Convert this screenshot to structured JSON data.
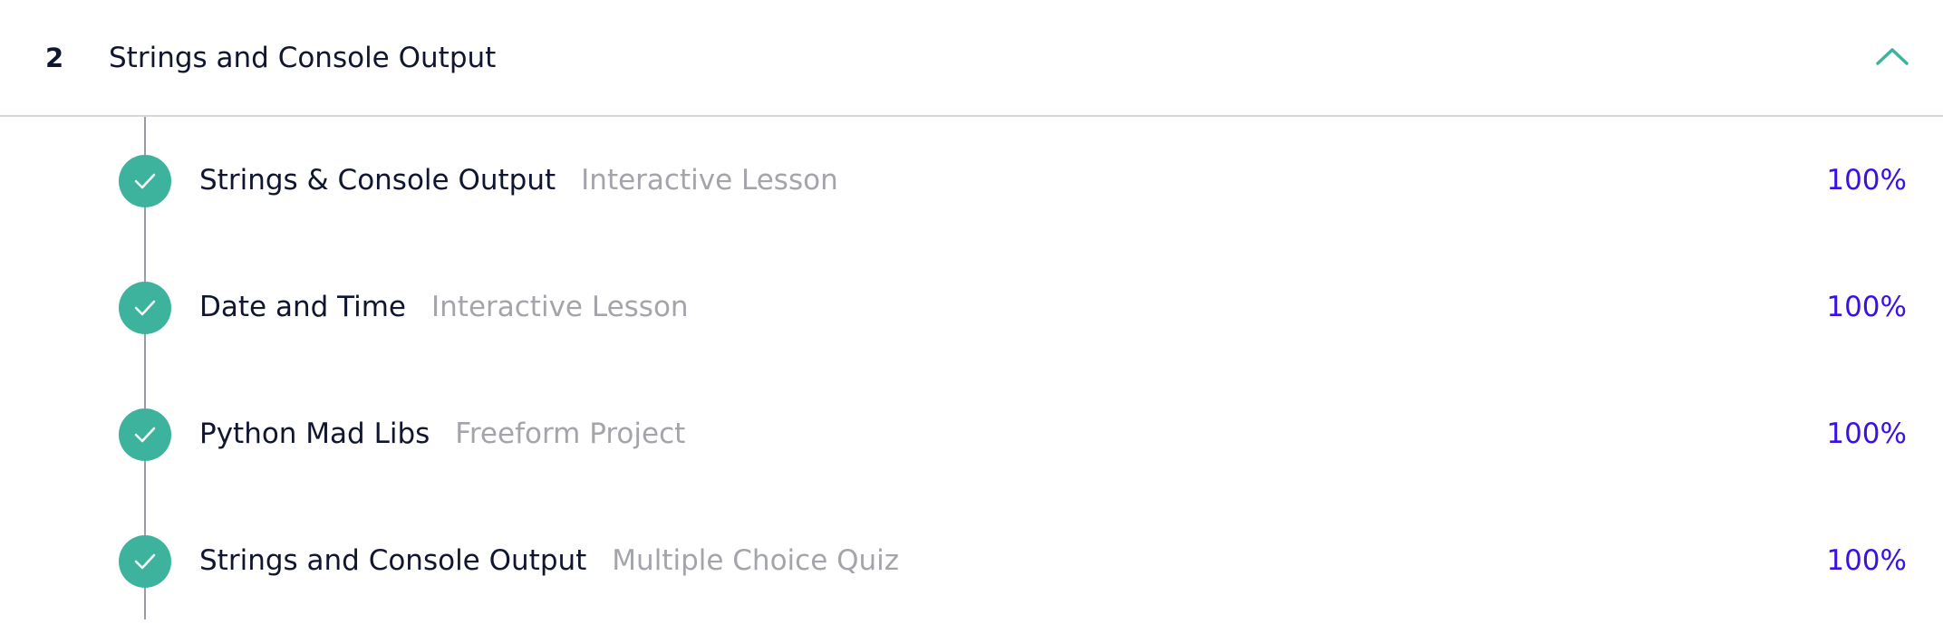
{
  "section": {
    "number": "2",
    "title": "Strings and Console Output",
    "expanded": true,
    "accent_color": "#3db39e"
  },
  "colors": {
    "check": "#3db39e",
    "percent": "#3a10e5",
    "type_text": "#a4a5ab",
    "title_text": "#10162f"
  },
  "items": [
    {
      "title": "Strings & Console Output",
      "type": "Interactive Lesson",
      "progress": "100%",
      "completed": true
    },
    {
      "title": "Date and Time",
      "type": "Interactive Lesson",
      "progress": "100%",
      "completed": true
    },
    {
      "title": "Python Mad Libs",
      "type": "Freeform Project",
      "progress": "100%",
      "completed": true
    },
    {
      "title": "Strings and Console Output",
      "type": "Multiple Choice Quiz",
      "progress": "100%",
      "completed": true
    }
  ]
}
